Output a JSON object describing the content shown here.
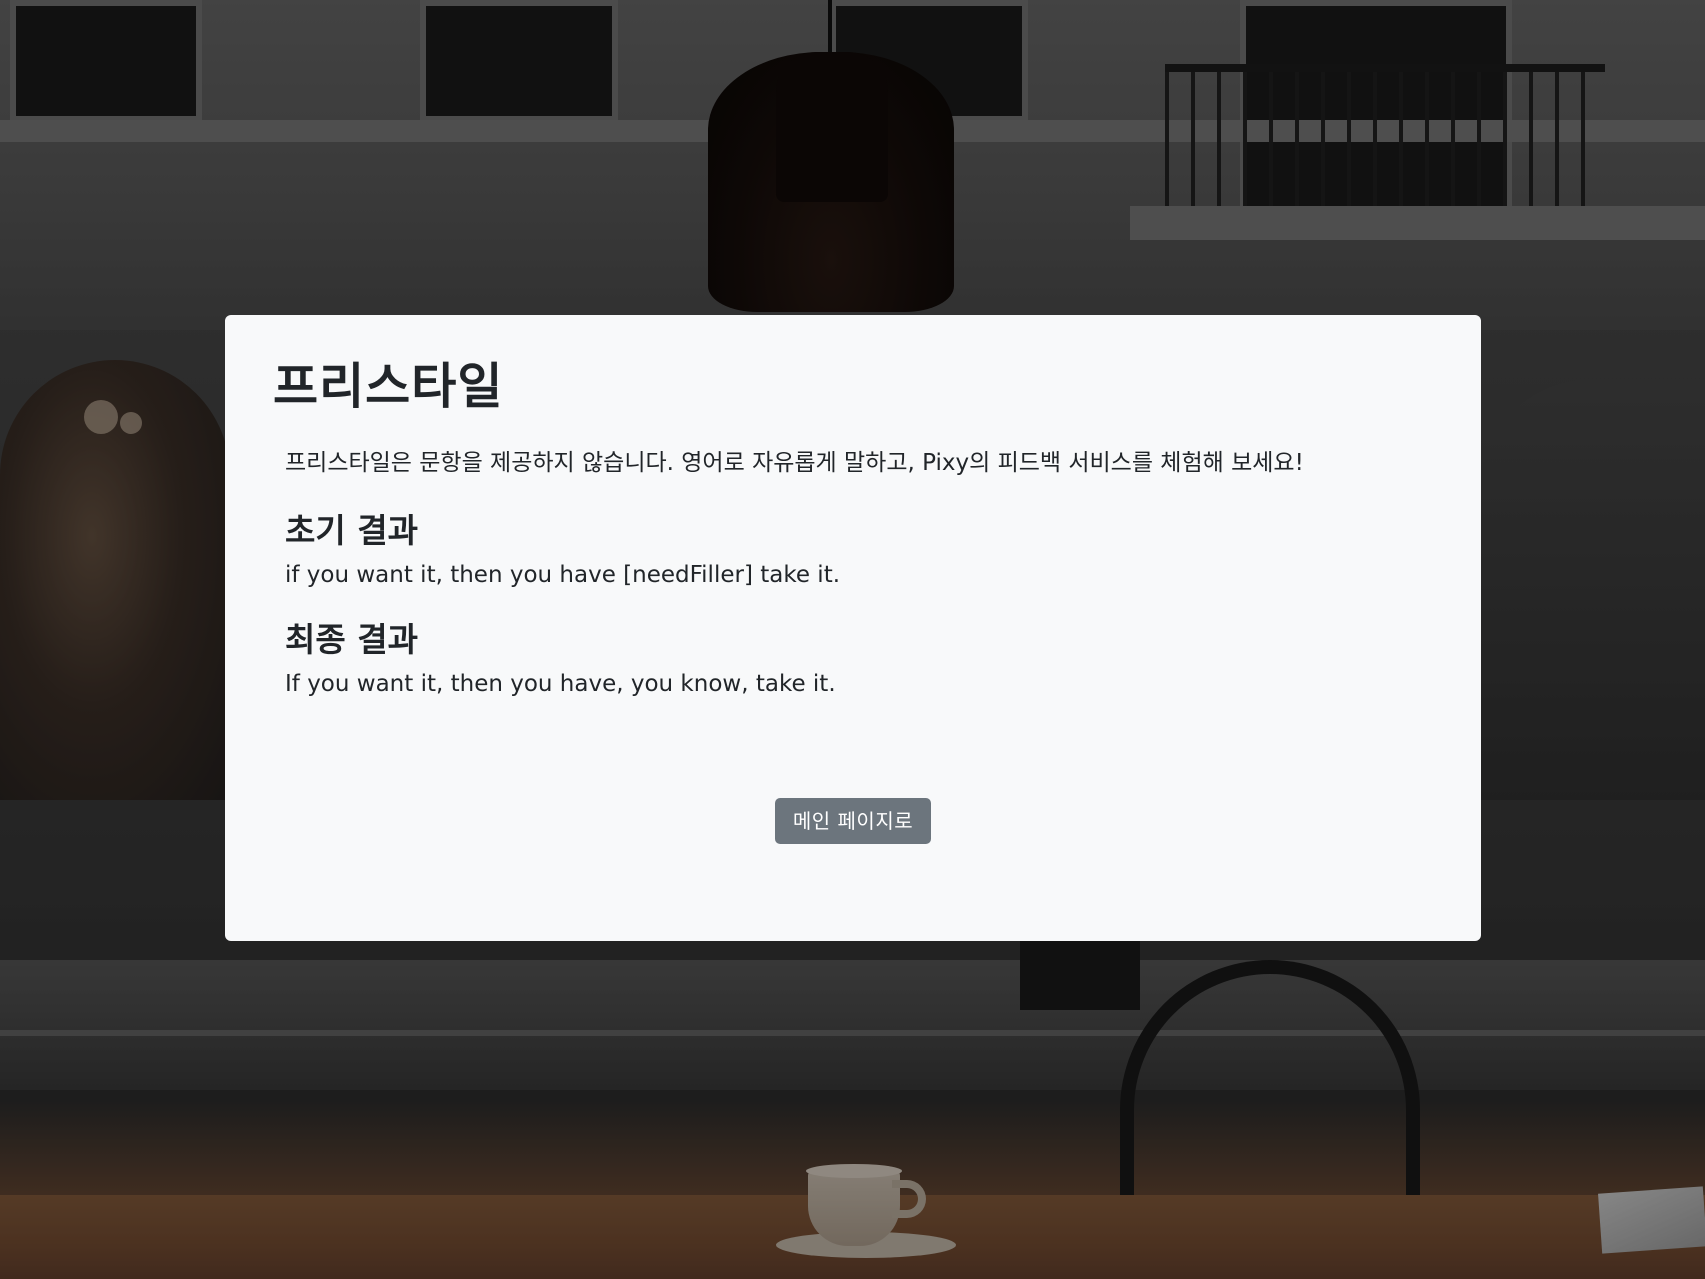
{
  "card": {
    "title": "프리스타일",
    "intro": "프리스타일은 문항을 제공하지 않습니다. 영어로 자유롭게 말하고, Pixy의 피드백 서비스를 체험해 보세요!",
    "sections": [
      {
        "heading": "초기 결과",
        "text": "if you want it, then you have [needFiller] take it."
      },
      {
        "heading": "최종 결과",
        "text": "If you want it, then you have, you know, take it."
      }
    ],
    "button_label": "메인 페이지로"
  },
  "colors": {
    "card_background": "#f8f9fa",
    "text": "#212529",
    "button_background": "#6c757d",
    "button_text": "#ffffff"
  }
}
